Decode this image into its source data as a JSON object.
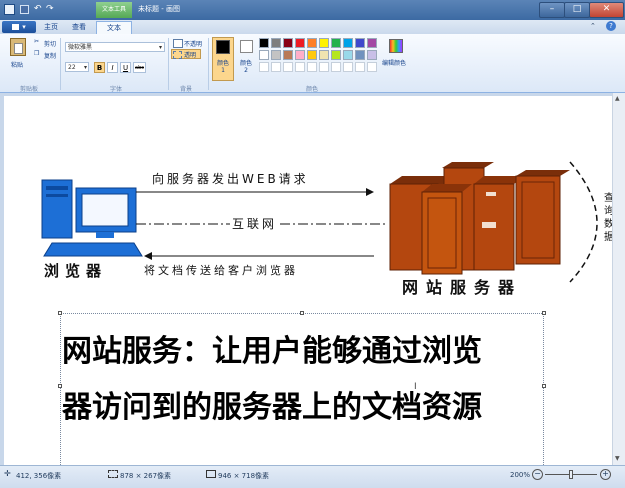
{
  "titlebar": {
    "context_tab": "文本工具",
    "title": "未标题 - 画图"
  },
  "ribbon_tabs": {
    "app_menu": "▾",
    "home": "主页",
    "view": "查看",
    "text": "文本"
  },
  "clipboard": {
    "paste": "粘贴",
    "cut": "剪切",
    "copy": "复制",
    "group": "剪贴板"
  },
  "font": {
    "family": "微软雅黑",
    "size": "22",
    "bold": "B",
    "italic": "I",
    "underline": "U",
    "strike": "abc",
    "group": "字体"
  },
  "background": {
    "opaque": "不透明",
    "transparent": "透明",
    "group": "背景"
  },
  "colors": {
    "color1": "颜色 1",
    "color2": "颜色 2",
    "edit": "编辑颜色",
    "group": "颜色",
    "palette": [
      "#000000",
      "#7f7f7f",
      "#880015",
      "#ed1c24",
      "#ff7f27",
      "#fff200",
      "#22b14c",
      "#00a2e8",
      "#3f48cc",
      "#a349a4",
      "#ffffff",
      "#c3c3c3",
      "#b97a57",
      "#ffaec9",
      "#ffc90e",
      "#efe4b0",
      "#b5e61d",
      "#99d9ea",
      "#7092be",
      "#c8bfe7"
    ]
  },
  "diagram": {
    "top_arrow_label": "向服务器发出WEB请求",
    "middle_label": "互联网",
    "bottom_arrow_label": "将文档传送给客户浏览器",
    "browser_label": "浏览器",
    "server_label": "网站服务器",
    "right_clipped_text": "查询数据"
  },
  "textbox": {
    "line1": "网站服务：让用户能够通过浏览",
    "line2": "器访问到的服务器上的文档资源"
  },
  "status": {
    "cursor_pos": "412, 356像素",
    "selection_size": "878 × 267像素",
    "image_size": "946 × 718像素",
    "zoom": "200%"
  }
}
